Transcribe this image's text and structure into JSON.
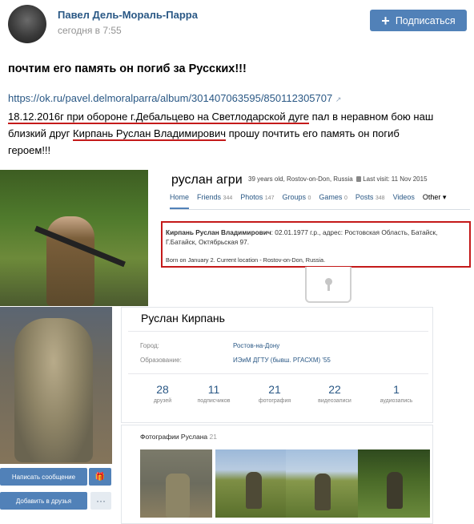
{
  "post": {
    "author": "Павел Дель-Мораль-Парра",
    "time": "сегодня в 7:55",
    "subscribe_label": "Подписаться",
    "subscribe_icon": "+",
    "headline": "почтим его память он погиб за Русских!!!",
    "url": "https://ok.ru/pavel.delmoralparra/album/301407063595/850112305707",
    "url_ext": "↗",
    "body_u1": "18.12.2016г при обороне г.Дебальцево на Светлодарской дуге",
    "body_t1": " пал в неравном бою наш",
    "body_t2": "близкий друг ",
    "body_u2": "Кирпань Руслан Владимирович",
    "body_t3": " прошу почтить его память он погиб",
    "body_t4": "героем!!!"
  },
  "profile_top": {
    "name": "руслан агри",
    "meta_age": "39 years old, Rostov-on-Don, Russia",
    "meta_last": "Last visit: 11 Nov 2015",
    "tabs": [
      {
        "label": "Home",
        "count": ""
      },
      {
        "label": "Friends",
        "count": "344"
      },
      {
        "label": "Photos",
        "count": "147"
      },
      {
        "label": "Groups",
        "count": "0"
      },
      {
        "label": "Games",
        "count": "0"
      },
      {
        "label": "Posts",
        "count": "348"
      },
      {
        "label": "Videos",
        "count": ""
      },
      {
        "label": "Other ▾",
        "count": ""
      }
    ],
    "info_name": "Кирпань Руслан Владимирович",
    "info_rest": ": 02.01.1977 г.р., адрес: Ростовская Область, Батайск, Г.Батайск, Октябрьская 97.",
    "born": "Born on January 2. Current location - Rostov-on-Don, Russia."
  },
  "profile_bottom": {
    "name": "Руслан Кирпань",
    "city_label": "Город:",
    "city_value": "Ростов-на-Дону",
    "edu_label": "Образование:",
    "edu_value": "ИЭиМ ДГТУ (бывш. РГАСХМ) '55",
    "stats": [
      {
        "n": "28",
        "l": "друзей"
      },
      {
        "n": "11",
        "l": "подписчиков"
      },
      {
        "n": "21",
        "l": "фотография"
      },
      {
        "n": "22",
        "l": "видеозаписи"
      },
      {
        "n": "1",
        "l": "аудиозапись"
      }
    ],
    "photos_title": "Фотографии Руслана",
    "photos_count": "21"
  },
  "buttons": {
    "message": "Написать сообщение",
    "gift_icon": "🎁",
    "add_friend": "Добавить в друзья",
    "more": "···"
  }
}
